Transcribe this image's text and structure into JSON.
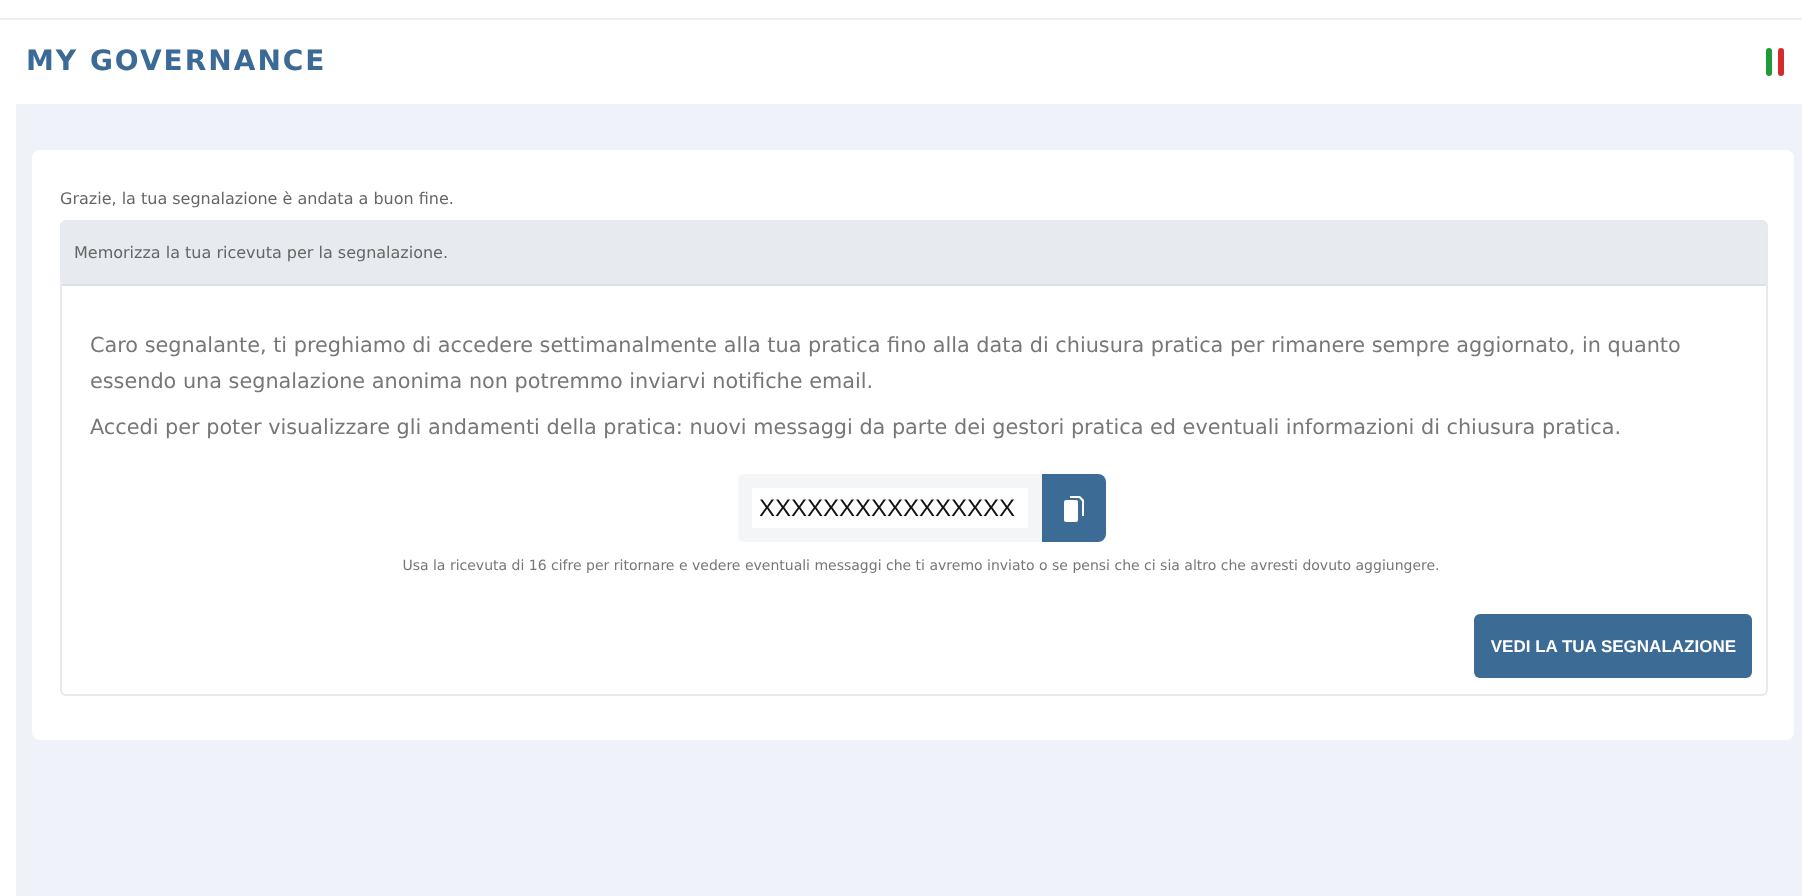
{
  "header": {
    "title": "MY GOVERNANCE"
  },
  "success_message": "Grazie, la tua segnalazione è andata a buon fine.",
  "panel": {
    "heading": "Memorizza la tua ricevuta per la segnalazione.",
    "paragraphs": [
      "Caro segnalante, ti preghiamo di accedere settimanalmente alla tua pratica fino alla data di chiusura pratica per rimanere sempre aggiornato, in quanto essendo una segnalazione anonima non potremmo inviarvi notifiche email.",
      "Accedi per poter visualizzare gli andamenti della pratica: nuovi messaggi da parte dei gestori pratica ed eventuali informazioni di chiusura pratica."
    ],
    "receipt": {
      "value": "XXXXXXXXXXXXXXXX"
    },
    "hint": "Usa la ricevuta di 16 cifre per ritornare e vedere eventuali messaggi che ti avremo inviato o se pensi che ci sia altro che avresti dovuto aggiungere.",
    "button": "VEDI LA TUA SEGNALAZIONE"
  }
}
